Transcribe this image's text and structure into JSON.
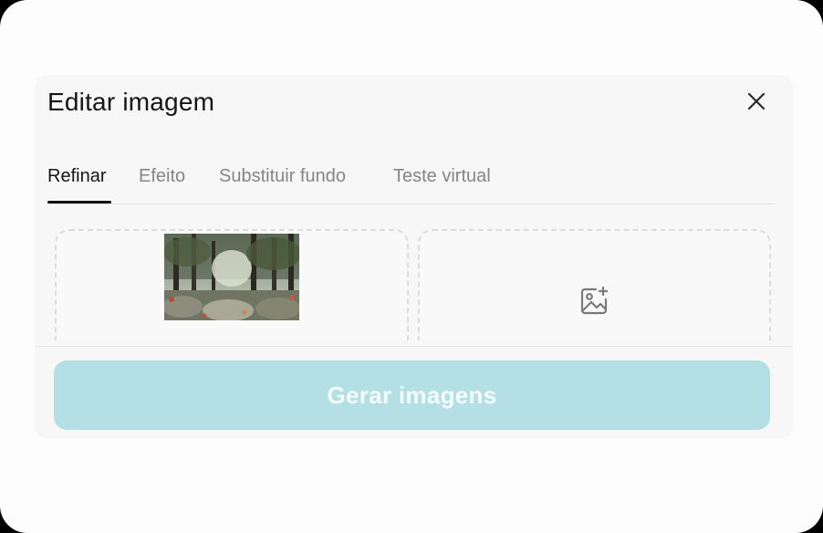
{
  "dialog": {
    "title": "Editar imagem",
    "close_icon": "close-icon"
  },
  "tabs": [
    {
      "label": "Refinar",
      "active": true
    },
    {
      "label": "Efeito",
      "active": false
    },
    {
      "label": "Substituir fundo",
      "active": false
    },
    {
      "label": "Teste virtual",
      "active": false
    }
  ],
  "upload": {
    "left_slot": "uploaded forest photo thumbnail",
    "right_icon": "image-add-icon"
  },
  "footer": {
    "generate_label": "Gerar imagens"
  },
  "colors": {
    "generate_button": "#b3dfe5",
    "active_tab": "#151515",
    "inactive_tab": "#858585"
  }
}
